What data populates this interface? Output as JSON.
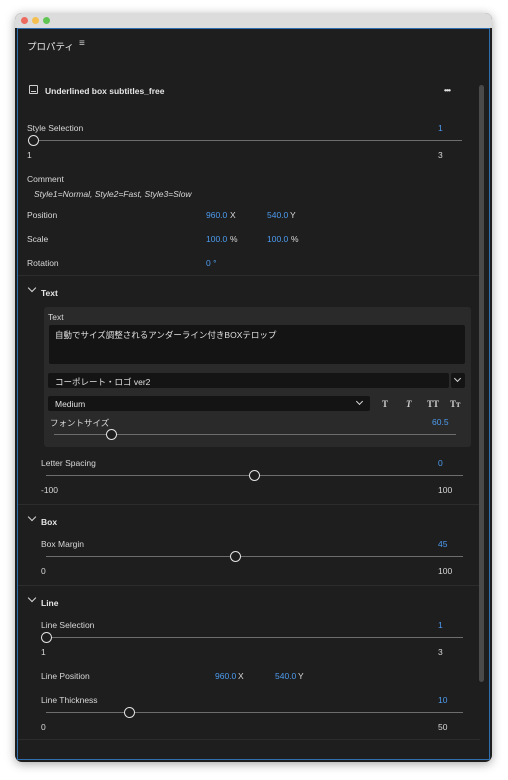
{
  "window": {
    "colors": {
      "accent": "#4d9cf0",
      "border": "#2f6fb0"
    }
  },
  "panel": {
    "title": "プロパティ",
    "menu_icon": "≡"
  },
  "clip": {
    "icon": "text-clip-icon",
    "title": "Underlined box subtitles_free",
    "more_icon": "•••"
  },
  "style_selection": {
    "label": "Style Selection",
    "value": "1",
    "min": "1",
    "max": "3",
    "position": 0.0
  },
  "comment": {
    "label": "Comment",
    "text": "Style1=Normal, Style2=Fast, Style3=Slow"
  },
  "position": {
    "label": "Position",
    "x": "960.0",
    "x_unit": "X",
    "y": "540.0",
    "y_unit": "Y"
  },
  "scale": {
    "label": "Scale",
    "w": "100.0",
    "w_unit": "%",
    "h": "100.0",
    "h_unit": "%"
  },
  "rotation": {
    "label": "Rotation",
    "value": "0 °"
  },
  "text_section": {
    "title": "Text",
    "group_label": "Text",
    "content": "自動でサイズ調整されるアンダーライン付きBOXテロップ",
    "font": "コーポレート・ロゴ ver2",
    "weight": "Medium",
    "style_buttons": [
      "T",
      "T",
      "TT",
      "Tт"
    ],
    "font_size_label": "フォントサイズ",
    "font_size_value": "60.5",
    "font_size_position": 0.14,
    "letter_spacing": {
      "label": "Letter Spacing",
      "value": "0",
      "min": "-100",
      "max": "100",
      "position": 0.5
    }
  },
  "box_section": {
    "title": "Box",
    "margin": {
      "label": "Box Margin",
      "value": "45",
      "min": "0",
      "max": "100",
      "position": 0.45
    }
  },
  "line_section": {
    "title": "Line",
    "selection": {
      "label": "Line Selection",
      "value": "1",
      "min": "1",
      "max": "3",
      "position": 0.0
    },
    "position": {
      "label": "Line Position",
      "x": "960.0",
      "x_unit": "X",
      "y": "540.0",
      "y_unit": "Y"
    },
    "thickness": {
      "label": "Line Thickness",
      "value": "10",
      "min": "0",
      "max": "50",
      "position": 0.2
    }
  }
}
